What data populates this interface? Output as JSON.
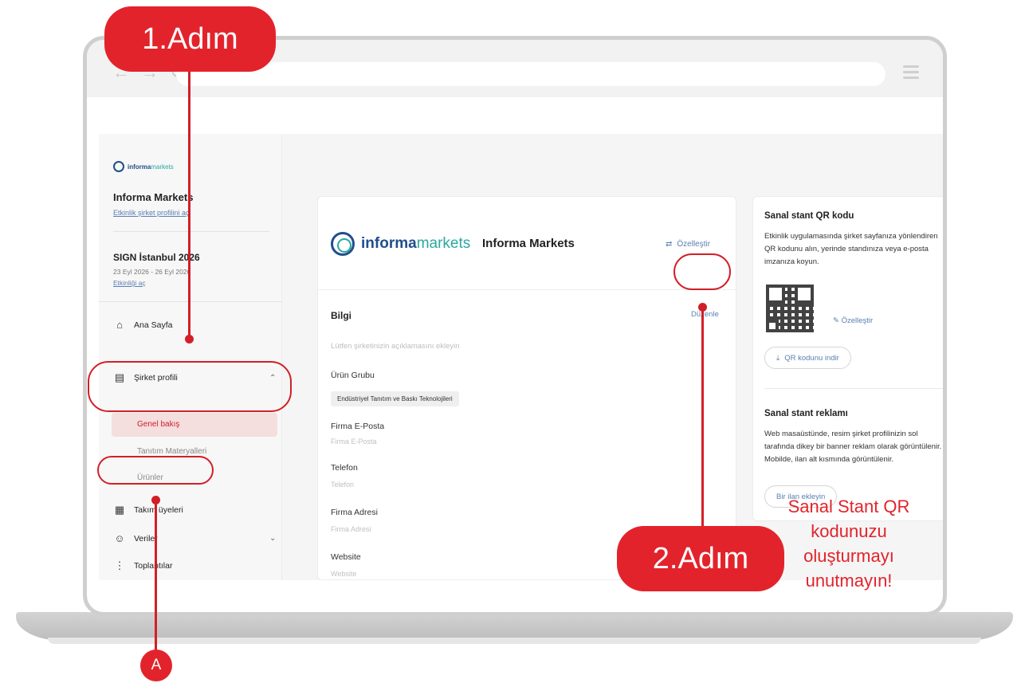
{
  "sidebar": {
    "logo_prefix": "informa",
    "logo_suffix": "markets",
    "org_name": "Informa Markets",
    "org_link": "Etkinlik şirket profilini aç",
    "event_name": "SIGN İstanbul 2026",
    "event_dates": "23 Eyl 2026 - 26 Eyl 2026",
    "event_link": "Etkinliği aç",
    "nav": {
      "home": "Ana Sayfa",
      "company_profile": "Şirket profili",
      "overview": "Genel bakış",
      "promo_materials": "Tanıtım Materyalleri",
      "products": "Ürünler",
      "team_members": "Takım üyeleri",
      "data": "Veriler",
      "meetings": "Toplantılar"
    }
  },
  "main": {
    "brand_prefix": "informa",
    "brand_suffix": "markets",
    "title": "Informa Markets",
    "customize_label": "Özelleştir",
    "section_title": "Bilgi",
    "edit_label": "Düzenle",
    "description_placeholder": "Lütfen şirketinizin açıklamasını ekleyin",
    "product_group_label": "Ürün Grubu",
    "product_group_tag": "Endüstriyel Tanıtım ve Baskı Teknolojileri",
    "email_label": "Firma E-Posta",
    "email_placeholder": "Firma E-Posta",
    "phone_label": "Telefon",
    "phone_placeholder": "Telefon",
    "address_label": "Firma Adresi",
    "address_placeholder": "Firma Adresi",
    "website_label": "Website",
    "website_placeholder": "Website"
  },
  "right_panel": {
    "qr_title": "Sanal stant QR kodu",
    "qr_text": "Etkinlik uygulamasında şirket sayfanıza yönlendiren QR kodunu alın, yerinde standınıza veya e-posta imzanıza koyun.",
    "qr_edit": "Özelleştir",
    "qr_download": "QR kodunu indir",
    "ad_title": "Sanal stant reklamı",
    "ad_text": "Web masaüstünde, resim şirket profilinizin sol tarafında dikey bir banner reklam olarak görüntülenir. Mobilde, ilan alt kısmında görüntülenir.",
    "ad_button": "Bir ilan ekleyin"
  },
  "annotations": {
    "step1": "1.Adım",
    "step2": "2.Adım",
    "marker_a": "A",
    "reminder": "Sanal Stant QR kodunuzu oluşturmayı unutmayın!"
  },
  "colors": {
    "accent_red": "#e3232b",
    "brand_blue": "#1f4e8c",
    "brand_teal": "#2aa8a0",
    "link_blue": "#5a7fb0"
  }
}
